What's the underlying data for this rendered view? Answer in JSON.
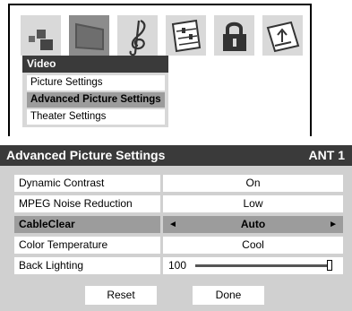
{
  "menu": {
    "icons": [
      {
        "name": "picture-icon",
        "selected": false
      },
      {
        "name": "video-screen-icon",
        "selected": true
      },
      {
        "name": "audio-clef-icon",
        "selected": false
      },
      {
        "name": "setup-settings-icon",
        "selected": false
      },
      {
        "name": "lock-icon",
        "selected": false
      },
      {
        "name": "application-icon",
        "selected": false
      }
    ],
    "title": "Video",
    "items": [
      {
        "label": "Picture Settings",
        "active": false
      },
      {
        "label": "Advanced Picture Settings",
        "active": true
      },
      {
        "label": "Theater Settings",
        "active": false
      }
    ]
  },
  "dialog": {
    "title": "Advanced Picture Settings",
    "source": "ANT 1",
    "rows": [
      {
        "label": "Dynamic Contrast",
        "value": "On"
      },
      {
        "label": "MPEG Noise Reduction",
        "value": "Low"
      },
      {
        "label": "CableClear",
        "value": "Auto",
        "active": true
      },
      {
        "label": "Color Temperature",
        "value": "Cool"
      },
      {
        "label": "Back Lighting",
        "value": "100",
        "level": 1.0
      }
    ],
    "arrow_left": "◄",
    "arrow_right": "►",
    "buttons": {
      "reset": "Reset",
      "done": "Done"
    }
  }
}
